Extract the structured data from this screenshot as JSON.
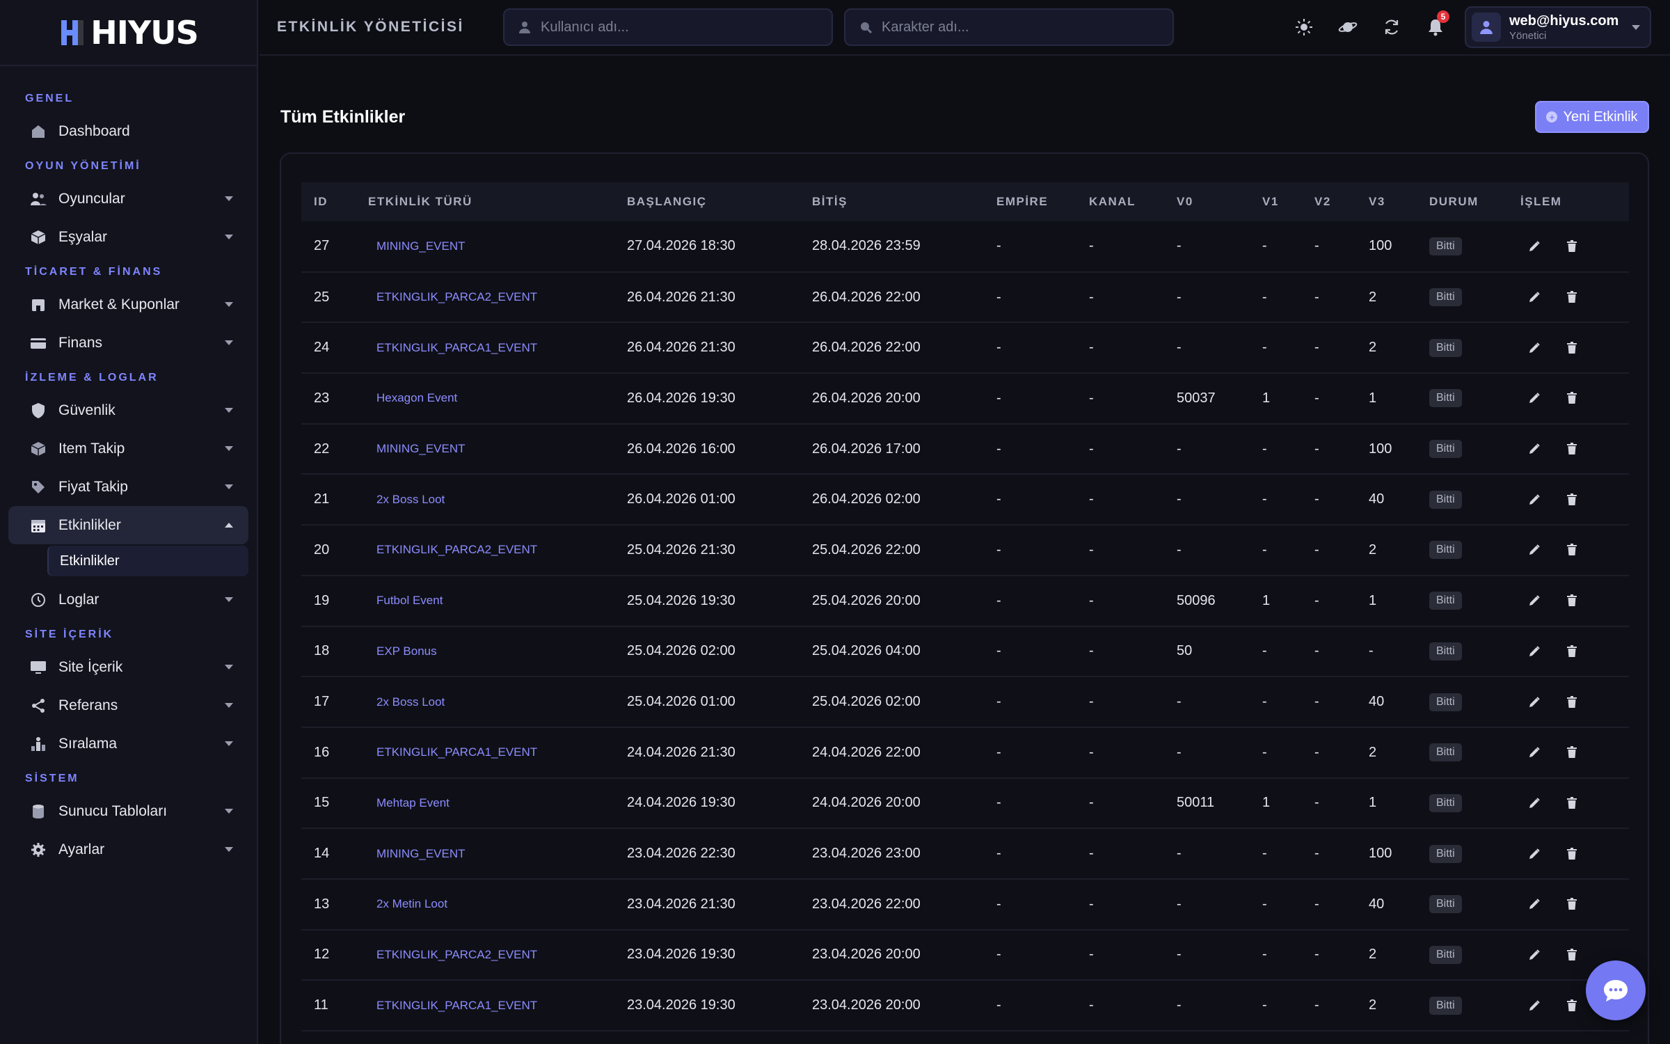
{
  "brand": {
    "logo_text": "HIYUS"
  },
  "sidebar": {
    "sections": [
      {
        "title": "GENEL",
        "items": [
          {
            "label": "Dashboard",
            "icon": "home-icon",
            "expandable": false
          }
        ]
      },
      {
        "title": "OYUN YÖNETİMİ",
        "items": [
          {
            "label": "Oyuncular",
            "icon": "users-icon",
            "expandable": true
          },
          {
            "label": "Eşyalar",
            "icon": "box-icon",
            "expandable": true
          }
        ]
      },
      {
        "title": "TİCARET & FİNANS",
        "items": [
          {
            "label": "Market & Kuponlar",
            "icon": "store-icon",
            "expandable": true
          },
          {
            "label": "Finans",
            "icon": "wallet-icon",
            "expandable": true
          }
        ]
      },
      {
        "title": "İZLEME & LOGLAR",
        "items": [
          {
            "label": "Güvenlik",
            "icon": "shield-icon",
            "expandable": true
          },
          {
            "label": "Item Takip",
            "icon": "cube-icon",
            "expandable": true
          },
          {
            "label": "Fiyat Takip",
            "icon": "tag-icon",
            "expandable": true
          },
          {
            "label": "Etkinlikler",
            "icon": "calendar-icon",
            "expandable": true,
            "active": true,
            "sub": "Etkinlikler"
          },
          {
            "label": "Loglar",
            "icon": "history-icon",
            "expandable": true
          }
        ]
      },
      {
        "title": "SİTE İÇERİK",
        "items": [
          {
            "label": "Site İçerik",
            "icon": "monitor-icon",
            "expandable": true
          },
          {
            "label": "Referans",
            "icon": "share-icon",
            "expandable": true
          },
          {
            "label": "Sıralama",
            "icon": "ranking-icon",
            "expandable": true
          }
        ]
      },
      {
        "title": "SİSTEM",
        "items": [
          {
            "label": "Sunucu Tabloları",
            "icon": "database-icon",
            "expandable": true
          },
          {
            "label": "Ayarlar",
            "icon": "gear-icon",
            "expandable": true
          }
        ]
      }
    ]
  },
  "topbar": {
    "page_label": "ETKİNLİK YÖNETİCİSİ",
    "user_search_placeholder": "Kullanıcı adı...",
    "character_search_placeholder": "Karakter adı...",
    "notification_count": "5",
    "user_email": "web@hiyus.com",
    "user_role": "Yönetici"
  },
  "main": {
    "title": "Tüm Etkinlikler",
    "new_button": "Yeni Etkinlik"
  },
  "table": {
    "columns": [
      "ID",
      "ETKİNLİK TÜRÜ",
      "BAŞLANGIÇ",
      "BİTİŞ",
      "EMPİRE",
      "KANAL",
      "V0",
      "V1",
      "V2",
      "V3",
      "DURUM",
      "İŞLEM"
    ],
    "rows": [
      {
        "id": "27",
        "type": "MINING_EVENT",
        "start": "27.04.2026 18:30",
        "end": "28.04.2026 23:59",
        "empire": "-",
        "channel": "-",
        "v0": "-",
        "v1": "-",
        "v2": "-",
        "v3": "100",
        "status": "Bitti"
      },
      {
        "id": "25",
        "type": "ETKINGLIK_PARCA2_EVENT",
        "start": "26.04.2026 21:30",
        "end": "26.04.2026 22:00",
        "empire": "-",
        "channel": "-",
        "v0": "-",
        "v1": "-",
        "v2": "-",
        "v3": "2",
        "status": "Bitti"
      },
      {
        "id": "24",
        "type": "ETKINGLIK_PARCA1_EVENT",
        "start": "26.04.2026 21:30",
        "end": "26.04.2026 22:00",
        "empire": "-",
        "channel": "-",
        "v0": "-",
        "v1": "-",
        "v2": "-",
        "v3": "2",
        "status": "Bitti"
      },
      {
        "id": "23",
        "type": "Hexagon Event",
        "start": "26.04.2026 19:30",
        "end": "26.04.2026 20:00",
        "empire": "-",
        "channel": "-",
        "v0": "50037",
        "v1": "1",
        "v2": "-",
        "v3": "1",
        "status": "Bitti"
      },
      {
        "id": "22",
        "type": "MINING_EVENT",
        "start": "26.04.2026 16:00",
        "end": "26.04.2026 17:00",
        "empire": "-",
        "channel": "-",
        "v0": "-",
        "v1": "-",
        "v2": "-",
        "v3": "100",
        "status": "Bitti"
      },
      {
        "id": "21",
        "type": "2x Boss Loot",
        "start": "26.04.2026 01:00",
        "end": "26.04.2026 02:00",
        "empire": "-",
        "channel": "-",
        "v0": "-",
        "v1": "-",
        "v2": "-",
        "v3": "40",
        "status": "Bitti"
      },
      {
        "id": "20",
        "type": "ETKINGLIK_PARCA2_EVENT",
        "start": "25.04.2026 21:30",
        "end": "25.04.2026 22:00",
        "empire": "-",
        "channel": "-",
        "v0": "-",
        "v1": "-",
        "v2": "-",
        "v3": "2",
        "status": "Bitti"
      },
      {
        "id": "19",
        "type": "Futbol Event",
        "start": "25.04.2026 19:30",
        "end": "25.04.2026 20:00",
        "empire": "-",
        "channel": "-",
        "v0": "50096",
        "v1": "1",
        "v2": "-",
        "v3": "1",
        "status": "Bitti"
      },
      {
        "id": "18",
        "type": "EXP Bonus",
        "start": "25.04.2026 02:00",
        "end": "25.04.2026 04:00",
        "empire": "-",
        "channel": "-",
        "v0": "50",
        "v1": "-",
        "v2": "-",
        "v3": "-",
        "status": "Bitti"
      },
      {
        "id": "17",
        "type": "2x Boss Loot",
        "start": "25.04.2026 01:00",
        "end": "25.04.2026 02:00",
        "empire": "-",
        "channel": "-",
        "v0": "-",
        "v1": "-",
        "v2": "-",
        "v3": "40",
        "status": "Bitti"
      },
      {
        "id": "16",
        "type": "ETKINGLIK_PARCA1_EVENT",
        "start": "24.04.2026 21:30",
        "end": "24.04.2026 22:00",
        "empire": "-",
        "channel": "-",
        "v0": "-",
        "v1": "-",
        "v2": "-",
        "v3": "2",
        "status": "Bitti"
      },
      {
        "id": "15",
        "type": "Mehtap Event",
        "start": "24.04.2026 19:30",
        "end": "24.04.2026 20:00",
        "empire": "-",
        "channel": "-",
        "v0": "50011",
        "v1": "1",
        "v2": "-",
        "v3": "1",
        "status": "Bitti"
      },
      {
        "id": "14",
        "type": "MINING_EVENT",
        "start": "23.04.2026 22:30",
        "end": "23.04.2026 23:00",
        "empire": "-",
        "channel": "-",
        "v0": "-",
        "v1": "-",
        "v2": "-",
        "v3": "100",
        "status": "Bitti"
      },
      {
        "id": "13",
        "type": "2x Metin Loot",
        "start": "23.04.2026 21:30",
        "end": "23.04.2026 22:00",
        "empire": "-",
        "channel": "-",
        "v0": "-",
        "v1": "-",
        "v2": "-",
        "v3": "40",
        "status": "Bitti"
      },
      {
        "id": "12",
        "type": "ETKINGLIK_PARCA2_EVENT",
        "start": "23.04.2026 19:30",
        "end": "23.04.2026 20:00",
        "empire": "-",
        "channel": "-",
        "v0": "-",
        "v1": "-",
        "v2": "-",
        "v3": "2",
        "status": "Bitti"
      },
      {
        "id": "11",
        "type": "ETKINGLIK_PARCA1_EVENT",
        "start": "23.04.2026 19:30",
        "end": "23.04.2026 20:00",
        "empire": "-",
        "channel": "-",
        "v0": "-",
        "v1": "-",
        "v2": "-",
        "v3": "2",
        "status": "Bitti"
      }
    ]
  },
  "colors": {
    "accent": "#7b7ff5",
    "type_link": "#8d8cff",
    "badge_red": "#e5323a",
    "section_title": "#7f85ff"
  }
}
